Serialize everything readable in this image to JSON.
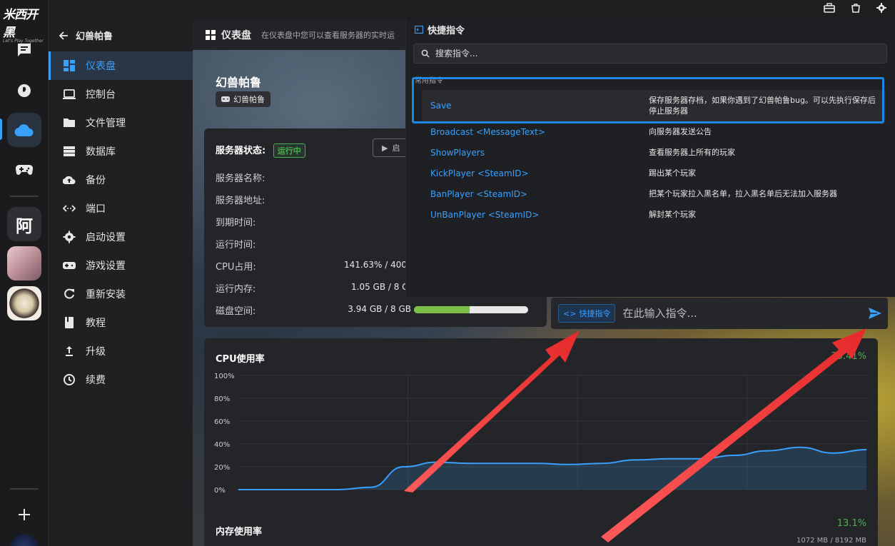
{
  "brand": {
    "logo_text": "米西开黑",
    "logo_sub": "Let's Play Together"
  },
  "rail": {
    "text_avatar": "阿"
  },
  "sidebar": {
    "back_title": "幻兽帕鲁",
    "items": [
      {
        "label": "仪表盘",
        "icon": "dashboard-icon",
        "active": true
      },
      {
        "label": "控制台",
        "icon": "console-icon"
      },
      {
        "label": "文件管理",
        "icon": "folder-icon"
      },
      {
        "label": "数据库",
        "icon": "database-icon"
      },
      {
        "label": "备份",
        "icon": "backup-icon"
      },
      {
        "label": "端口",
        "icon": "port-icon"
      },
      {
        "label": "启动设置",
        "icon": "gear-icon"
      },
      {
        "label": "游戏设置",
        "icon": "gamepad-icon"
      },
      {
        "label": "重新安装",
        "icon": "reinstall-icon"
      },
      {
        "label": "教程",
        "icon": "book-icon"
      },
      {
        "label": "升级",
        "icon": "upgrade-icon"
      },
      {
        "label": "续费",
        "icon": "renew-icon"
      }
    ]
  },
  "dashboard": {
    "title": "仪表盘",
    "desc": "在仪表盘中您可以查看服务器的实时运",
    "server_name": "幻兽帕鲁",
    "server_tag": "幻兽帕鲁"
  },
  "status": {
    "label": "服务器状态:",
    "state": "运行中",
    "start_label": "启",
    "rows": [
      {
        "label": "服务器名称:",
        "value": ""
      },
      {
        "label": "服务器地址:",
        "value": ""
      },
      {
        "label": "到期时间:",
        "value": ""
      },
      {
        "label": "运行时间:",
        "value": ""
      },
      {
        "label": "CPU占用:",
        "value": "141.63% / 400%"
      },
      {
        "label": "运行内存:",
        "value": "1.05 GB / 8 G"
      },
      {
        "label": "磁盘空间:",
        "value": "3.94 GB / 8 GB"
      }
    ],
    "disk_fill_fraction": 0.49
  },
  "cpu": {
    "title": "CPU使用率",
    "percent": "35.41%",
    "y_ticks": [
      "100%",
      "80%",
      "60%",
      "40%",
      "20%",
      "0%"
    ]
  },
  "chart_data": {
    "type": "area",
    "title": "CPU使用率",
    "ylim": [
      0,
      100
    ],
    "y_ticks": [
      "0%",
      "20%",
      "40%",
      "60%",
      "80%",
      "100%"
    ],
    "x": [
      0,
      1,
      2,
      3,
      4,
      5,
      6,
      7,
      8,
      9,
      10,
      11,
      12,
      13,
      14,
      15,
      16,
      17,
      18,
      19
    ],
    "series": [
      {
        "values": [
          0,
          0,
          0,
          0,
          2,
          20,
          24,
          23,
          23,
          23,
          22,
          23,
          26,
          27,
          27,
          30,
          34,
          37,
          32,
          35
        ]
      }
    ],
    "grid": true
  },
  "memory": {
    "title": "内存使用率",
    "percent": "13.1%",
    "sub": "1072 MB / 8192 MB"
  },
  "quick": {
    "title": "快捷指令",
    "search_placeholder": "搜索指令...",
    "section": "常用指令",
    "commands": [
      {
        "name": "Save",
        "desc": "保存服务器存档，如果你遇到了幻兽帕鲁bug。可以先执行保存后停止服务器"
      },
      {
        "name": "Broadcast <MessageText>",
        "desc": "向服务器发送公告"
      },
      {
        "name": "ShowPlayers",
        "desc": "查看服务器上所有的玩家"
      },
      {
        "name": "KickPlayer <SteamID>",
        "desc": "踢出某个玩家"
      },
      {
        "name": "BanPlayer <SteamID>",
        "desc": "把某个玩家拉入黑名单，拉入黑名单后无法加入服务器"
      },
      {
        "name": "UnBanPlayer <SteamID>",
        "desc": "解封某个玩家"
      }
    ]
  },
  "command_bar": {
    "chip": "快捷指令",
    "placeholder": "在此输入指令..."
  },
  "colors": {
    "accent": "#3aa0ff",
    "success": "#4caf50",
    "annotation_arrow": "#f03a3a"
  }
}
